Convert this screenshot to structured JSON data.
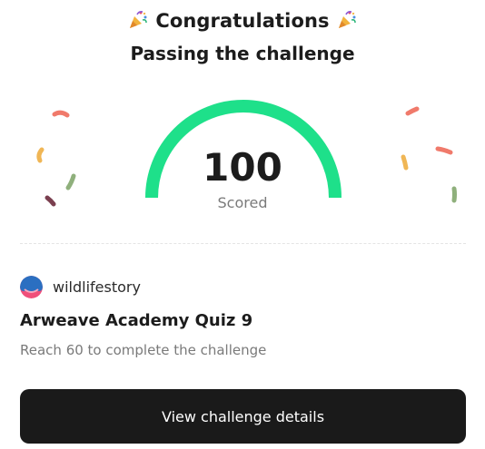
{
  "header": {
    "title": "Congratulations",
    "subtitle": "Passing the challenge",
    "title_icon": "party-popper-icon"
  },
  "score": {
    "value": "100",
    "label": "Scored",
    "fraction": 1.0,
    "color": "#1ee08a"
  },
  "challenge": {
    "author": "wildlifestory",
    "avatar_icon": "avatar-icon",
    "title": "Arweave Academy Quiz 9",
    "description": "Reach 60 to complete the challenge"
  },
  "actions": {
    "primary_label": "View challenge details"
  },
  "colors": {
    "button_bg": "#1a1a1a",
    "confetti": [
      "#f07a6b",
      "#f0b655",
      "#8fb07c",
      "#7a3f4f"
    ]
  }
}
